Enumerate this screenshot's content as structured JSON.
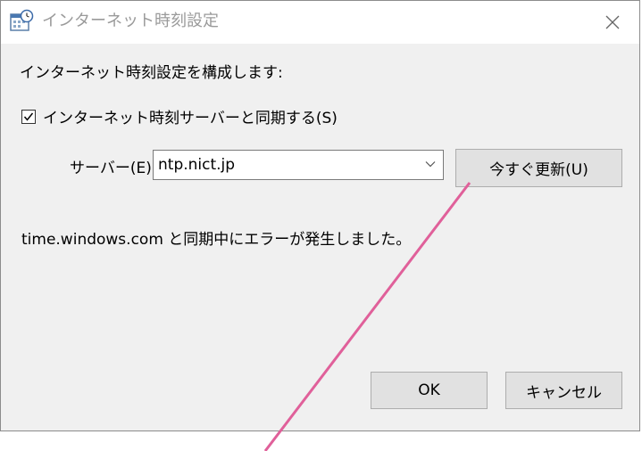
{
  "window": {
    "title": "インターネット時刻設定",
    "close_symbol": "✕"
  },
  "dialog": {
    "heading": "インターネット時刻設定を構成します:",
    "sync_checkbox_label": "インターネット時刻サーバーと同期する(S)",
    "sync_checked": true,
    "server_label": "サーバー(E):",
    "server_value": "ntp.nict.jp",
    "update_button": "今すぐ更新(U)",
    "status_message": "time.windows.com と同期中にエラーが発生しました。",
    "ok_button": "OK",
    "cancel_button": "キャンセル"
  },
  "icons": {
    "title": "calendar-clock-icon",
    "close": "close-icon",
    "dropdown": "chevron-down-icon",
    "checkbox": "check-icon"
  },
  "colors": {
    "annotation_line": "#e0609a",
    "dialog_bg": "#f0f0f0",
    "button_bg": "#e1e1e1"
  }
}
